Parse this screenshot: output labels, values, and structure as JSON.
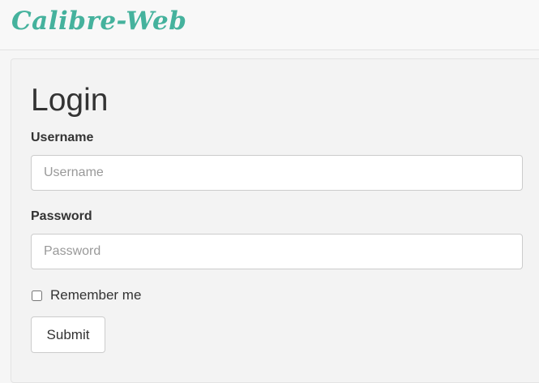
{
  "navbar": {
    "brand": "Calibre-Web"
  },
  "login": {
    "title": "Login",
    "username": {
      "label": "Username",
      "placeholder": "Username",
      "value": ""
    },
    "password": {
      "label": "Password",
      "placeholder": "Password",
      "value": ""
    },
    "remember_me": {
      "label": "Remember me",
      "checked": false
    },
    "submit_label": "Submit"
  },
  "colors": {
    "brand": "#45b29d",
    "panel_background": "#f3f3f3",
    "input_border": "#cccccc"
  }
}
